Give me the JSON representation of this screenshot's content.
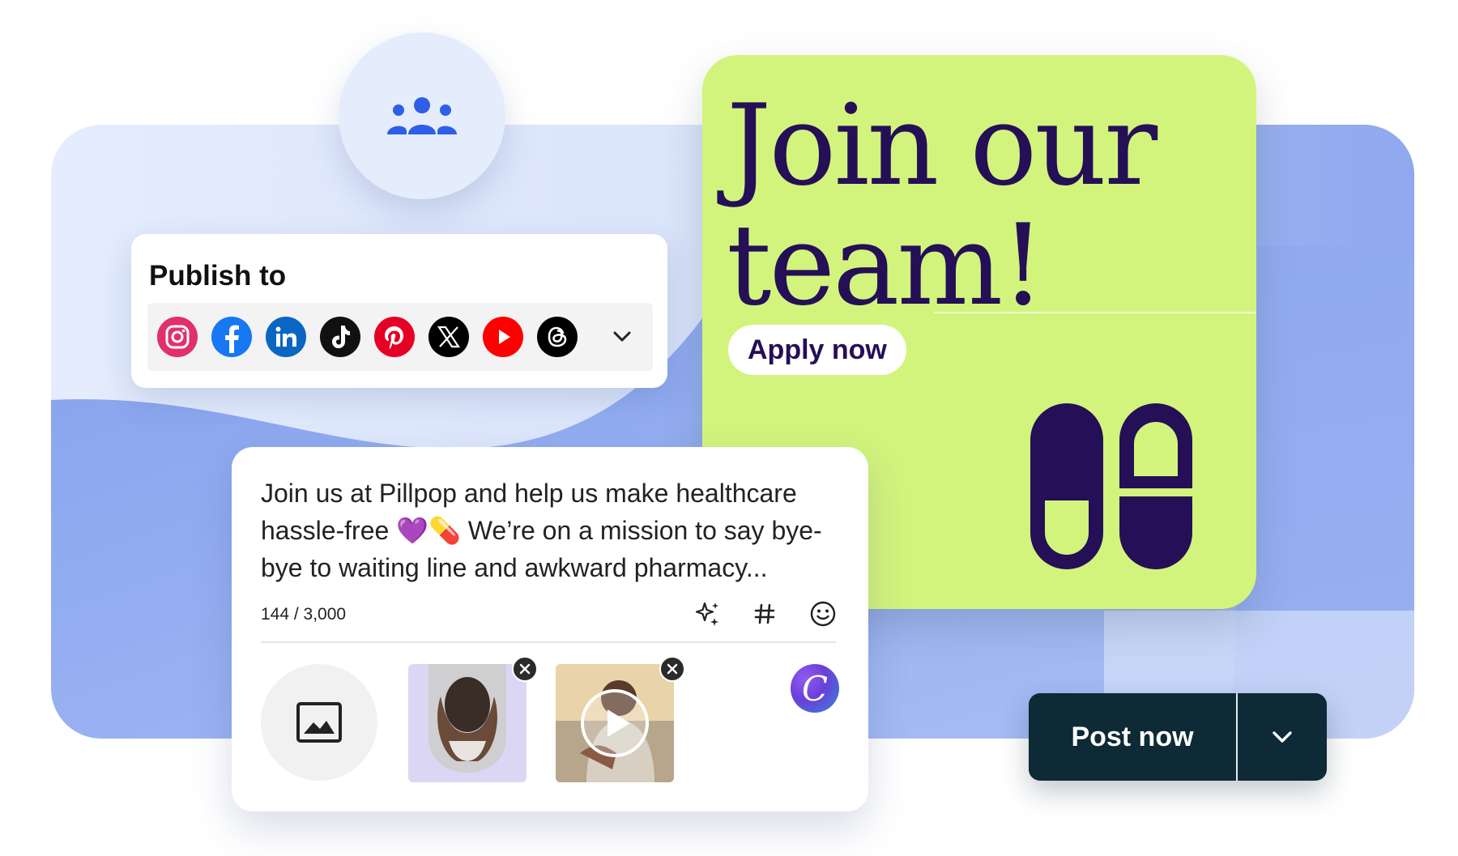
{
  "colors": {
    "poster_bg": "#d2f47d",
    "poster_ink": "#250f57",
    "post_button": "#0d2a36",
    "team_icon": "#2f5fe8",
    "panel_light": "#e4ecfd",
    "panel_blue": "#8fa9ef"
  },
  "team_badge": {
    "icon": "people-group-icon"
  },
  "publish": {
    "title": "Publish to",
    "networks": [
      {
        "name": "instagram",
        "icon": "instagram-icon",
        "color": "#e1306c"
      },
      {
        "name": "facebook",
        "icon": "facebook-icon",
        "color": "#1877f2"
      },
      {
        "name": "linkedin",
        "icon": "linkedin-icon",
        "color": "#0a66c2"
      },
      {
        "name": "tiktok",
        "icon": "tiktok-icon",
        "color": "#111111"
      },
      {
        "name": "pinterest",
        "icon": "pinterest-icon",
        "color": "#e60023"
      },
      {
        "name": "x",
        "icon": "x-icon",
        "color": "#000000"
      },
      {
        "name": "youtube",
        "icon": "youtube-icon",
        "color": "#ff0000"
      },
      {
        "name": "threads",
        "icon": "threads-icon",
        "color": "#000000"
      }
    ],
    "expand_icon": "chevron-down-icon"
  },
  "poster": {
    "headline_line1": "Join our",
    "headline_line2": "team!",
    "cta": "Apply now",
    "graphic": "pill-capsules-icon"
  },
  "composer": {
    "text": "Join us at Pillpop and help us make healthcare hassle-free 💜💊 We’re on a mission to say bye-bye to waiting line and awkward pharmacy...",
    "char_count": "144 / 3,000",
    "tools": [
      "ai-sparkle-icon",
      "hashtag-icon",
      "emoji-icon"
    ],
    "add_media_icon": "image-icon",
    "attachments": [
      {
        "type": "image",
        "remove_icon": "close-icon"
      },
      {
        "type": "video",
        "remove_icon": "close-icon",
        "overlay_icon": "play-icon"
      }
    ],
    "canva_letter": "C"
  },
  "post_button": {
    "label": "Post now",
    "menu_icon": "chevron-down-icon"
  }
}
